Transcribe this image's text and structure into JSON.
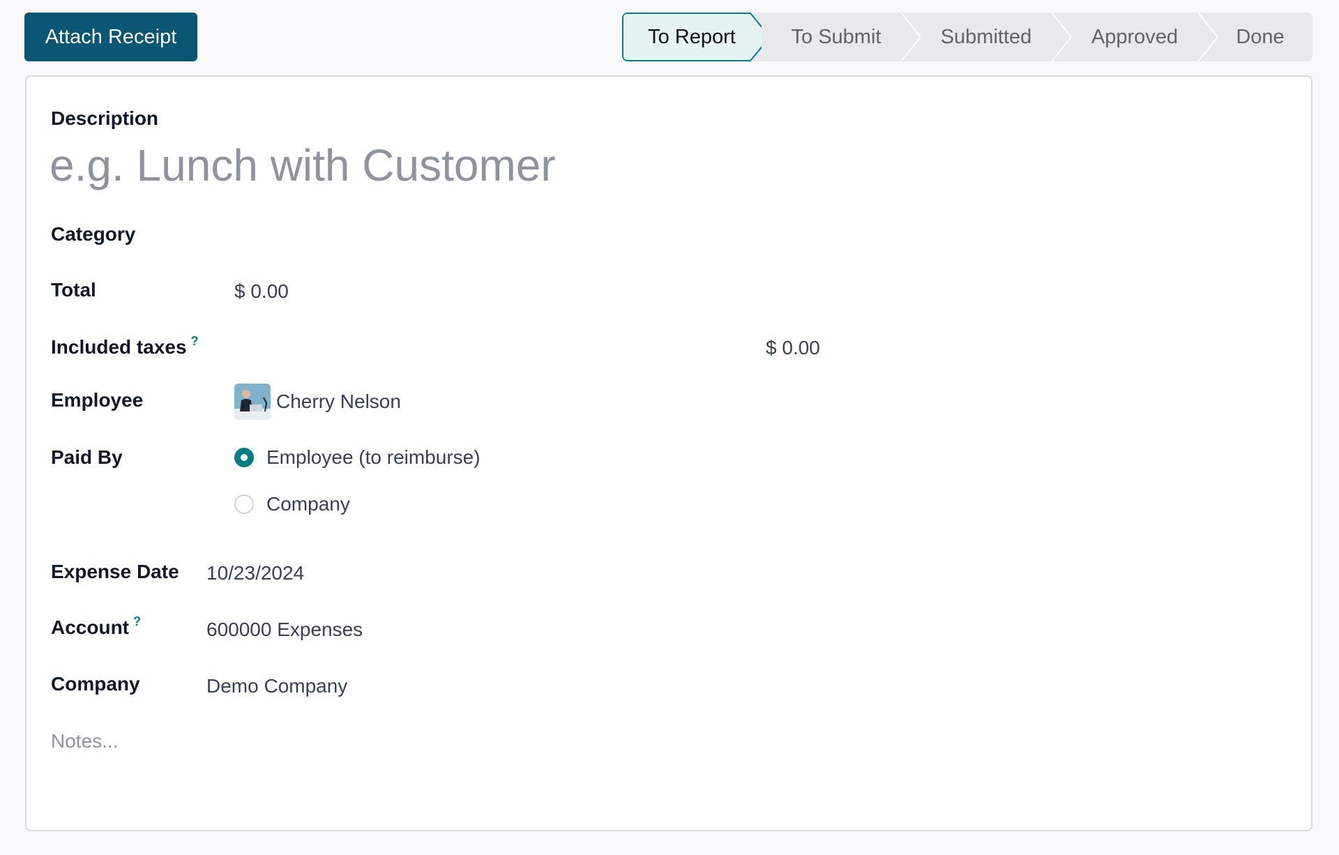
{
  "toolbar": {
    "attach_receipt_label": "Attach Receipt"
  },
  "statusbar": {
    "stages": [
      {
        "label": "To Report",
        "active": true
      },
      {
        "label": "To Submit",
        "active": false
      },
      {
        "label": "Submitted",
        "active": false
      },
      {
        "label": "Approved",
        "active": false
      },
      {
        "label": "Done",
        "active": false
      }
    ],
    "accent_color": "#017e84"
  },
  "form": {
    "description": {
      "label": "Description",
      "placeholder": "e.g. Lunch with Customer",
      "value": ""
    },
    "category": {
      "label": "Category",
      "value": ""
    },
    "total": {
      "label": "Total",
      "value": "$ 0.00"
    },
    "included_taxes": {
      "label": "Included taxes",
      "help": "?",
      "value": "$ 0.00"
    },
    "employee": {
      "label": "Employee",
      "value": "Cherry Nelson",
      "avatar_icon": "employee-avatar"
    },
    "paid_by": {
      "label": "Paid By",
      "options": [
        {
          "label": "Employee (to reimburse)",
          "selected": true
        },
        {
          "label": "Company",
          "selected": false
        }
      ]
    },
    "expense_date": {
      "label": "Expense Date",
      "value": "10/23/2024"
    },
    "account": {
      "label": "Account",
      "help": "?",
      "value": "600000 Expenses"
    },
    "company": {
      "label": "Company",
      "value": "Demo Company"
    },
    "notes": {
      "placeholder": "Notes..."
    }
  }
}
